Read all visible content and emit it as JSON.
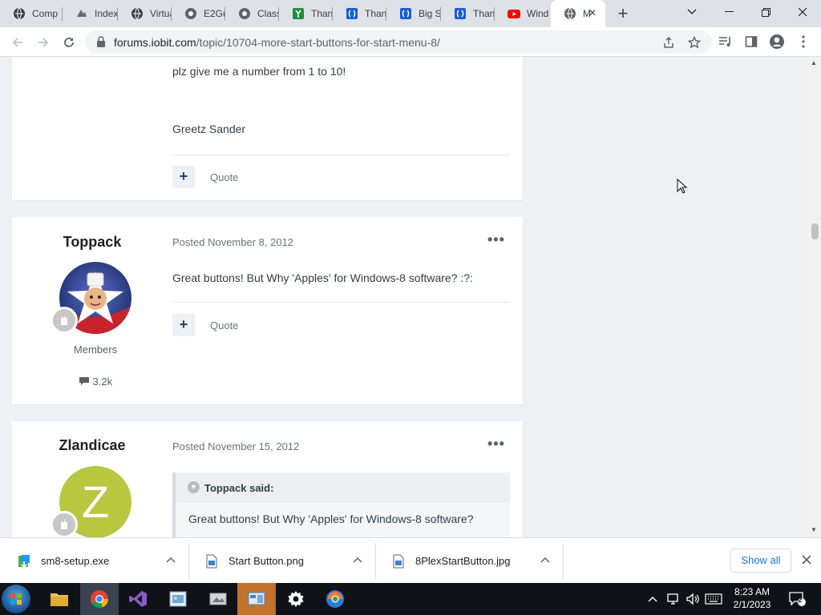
{
  "browser": {
    "tabs": [
      {
        "label": "Comp",
        "icon": "globe-dark-icon"
      },
      {
        "label": "Index",
        "icon": "site-icon"
      },
      {
        "label": "Virtua",
        "icon": "globe-dark-icon"
      },
      {
        "label": "E2Gu",
        "icon": "globe-icon"
      },
      {
        "label": "Class",
        "icon": "globe-icon"
      },
      {
        "label": "Thank",
        "icon": "green-y-icon"
      },
      {
        "label": "Thank",
        "icon": "blue-bracket-icon"
      },
      {
        "label": "Big S",
        "icon": "blue-bracket-icon"
      },
      {
        "label": "Thank",
        "icon": "blue-bracket-icon"
      },
      {
        "label": "Wind",
        "icon": "youtube-icon"
      },
      {
        "label": "M",
        "icon": "globe-icon",
        "active": true
      }
    ],
    "url_host": "forums.iobit.com",
    "url_path": "/topic/10704-more-start-buttons-for-start-menu-8/"
  },
  "posts": [
    {
      "lines": [
        "plz give me a number from 1 to 10!",
        "Greetz Sander"
      ],
      "quote_label": "Quote"
    },
    {
      "author": "Toppack",
      "group": "Members",
      "post_count": "3.2k",
      "posted": "Posted November 8, 2012",
      "text": "Great buttons! But Why 'Apples' for Windows-8 software? :?:",
      "quote_label": "Quote"
    },
    {
      "author": "Zlandicae",
      "avatar_letter": "Z",
      "posted": "Posted November 15, 2012",
      "quote_citation": "Toppack said:",
      "quote_text": "Great buttons! But Why 'Apples' for Windows-8 software?"
    }
  ],
  "downloads": {
    "items": [
      {
        "name": "sm8-setup.exe",
        "icon": "installer-icon"
      },
      {
        "name": "Start Button.png",
        "icon": "image-file-icon"
      },
      {
        "name": "8PlexStartButton.jpg",
        "icon": "image-file-icon"
      }
    ],
    "show_all": "Show all"
  },
  "taskbar": {
    "time": "8:23 AM",
    "date": "2/1/2023",
    "notifications": "2"
  },
  "colors": {
    "accent": "#1a73e8",
    "forum_bg": "#eef0f3",
    "plus_button": "#24456d",
    "avatar_z": "#b9c63f"
  }
}
